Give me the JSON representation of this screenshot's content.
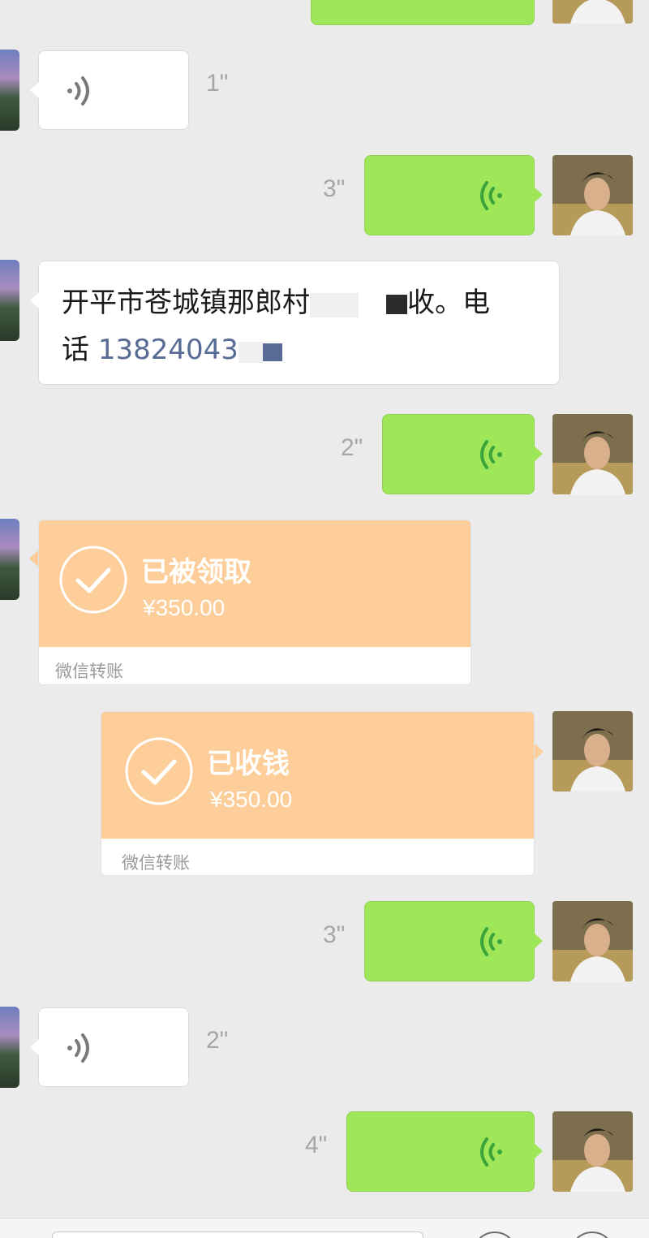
{
  "colors": {
    "background": "#ebebeb",
    "sent_bubble": "#9fe658",
    "received_bubble": "#ffffff",
    "transfer_card": "#fdce99",
    "link_blue": "#576b95",
    "duration_gray": "#a6a6a6"
  },
  "messages": [
    {
      "side": "right",
      "type": "voice-partial",
      "icon": "voice-wave-icon"
    },
    {
      "side": "left",
      "type": "voice",
      "duration": "1\"",
      "icon": "voice-wave-icon"
    },
    {
      "side": "right",
      "type": "voice",
      "duration": "3\"",
      "icon": "voice-wave-icon"
    },
    {
      "side": "left",
      "type": "text",
      "text": "开平市苍城镇那郎村",
      "text_suffix": "收。电",
      "line2_prefix": "话 ",
      "phone": "13824043"
    },
    {
      "side": "right",
      "type": "voice",
      "duration": "2\"",
      "icon": "voice-wave-icon"
    },
    {
      "side": "left",
      "type": "transfer",
      "title": "已被领取",
      "amount": "¥350.00",
      "footer": "微信转账",
      "icon": "check-circle-icon"
    },
    {
      "side": "right",
      "type": "transfer",
      "title": "已收钱",
      "amount": "¥350.00",
      "footer": "微信转账",
      "icon": "check-circle-icon"
    },
    {
      "side": "right",
      "type": "voice",
      "duration": "3\"",
      "icon": "voice-wave-icon"
    },
    {
      "side": "left",
      "type": "voice",
      "duration": "2\"",
      "icon": "voice-wave-icon"
    },
    {
      "side": "right",
      "type": "voice",
      "duration": "4\"",
      "icon": "voice-wave-icon"
    }
  ],
  "input_bar": {
    "text_field_value": "",
    "emoji_button_icon": "emoji-icon",
    "more_button_icon": "plus-icon"
  }
}
